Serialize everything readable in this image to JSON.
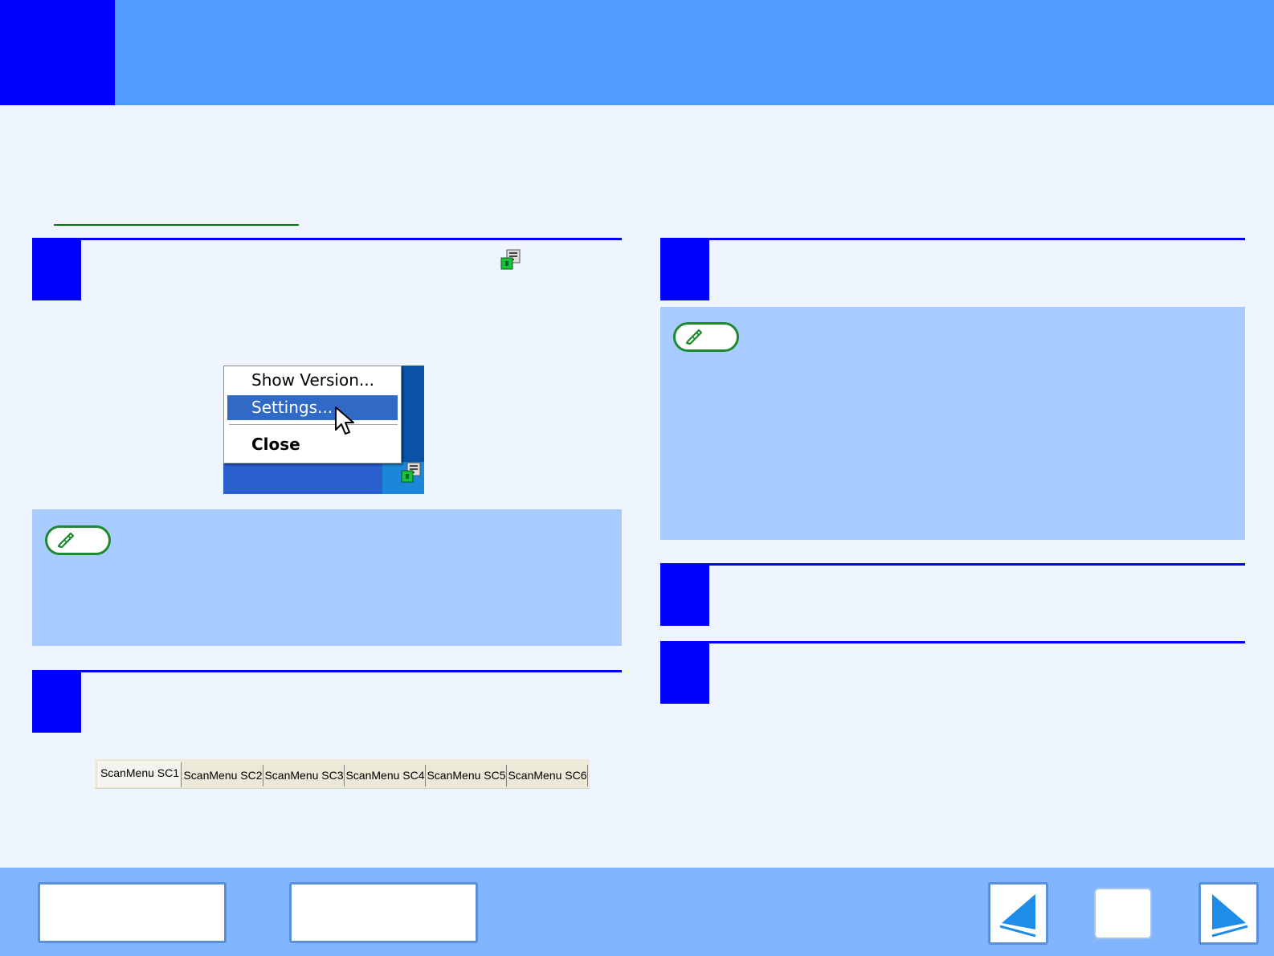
{
  "header": {
    "title": "",
    "chapter_color": "#0000ff",
    "bar_color": "#519aff"
  },
  "steps": [
    {
      "number": "",
      "text": ""
    },
    {
      "number": "",
      "text": ""
    },
    {
      "number": "",
      "text": ""
    },
    {
      "number": "",
      "text": ""
    },
    {
      "number": "",
      "text": ""
    }
  ],
  "context_menu": {
    "items": [
      {
        "label": "Show Version..."
      },
      {
        "label": "Settings...",
        "selected": true
      },
      {
        "label": "Close",
        "bold": true
      }
    ]
  },
  "tabs": [
    {
      "label": "ScanMenu SC1",
      "active": true
    },
    {
      "label": "ScanMenu SC2"
    },
    {
      "label": "ScanMenu SC3"
    },
    {
      "label": "ScanMenu SC4"
    },
    {
      "label": "ScanMenu SC5"
    },
    {
      "label": "ScanMenu SC6"
    }
  ],
  "icons": {
    "note": "note-pencil-icon",
    "tray": "button-manager-tray-icon",
    "cursor": "mouse-pointer-icon",
    "prev": "previous-page-icon",
    "next": "next-page-icon"
  },
  "colors": {
    "accent": "#0000ff",
    "note_bg": "#a8ccff",
    "page_bg": "#eef5ff",
    "footer_bg": "#81b6ff",
    "note_badge": "#1e8a2e"
  },
  "footer": {
    "contents_label": "",
    "index_label": ""
  }
}
